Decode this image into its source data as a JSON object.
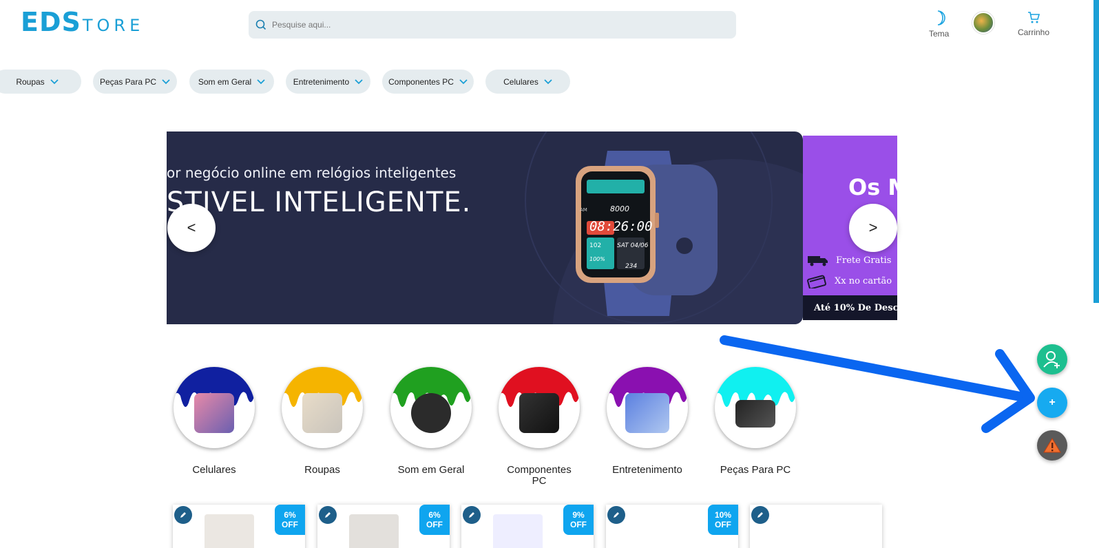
{
  "header": {
    "logo_strong": "EDS",
    "logo_light": "TORE",
    "search_placeholder": "Pesquise aqui...",
    "theme_label": "Tema",
    "cart_label": "Carrinho"
  },
  "nav": {
    "pills": [
      "Roupas",
      "Peças Para PC",
      "Som em Geral",
      "Entretenimento",
      "Componentes PC",
      "Celulares"
    ]
  },
  "carousel": {
    "slide_line1": "or negócio online em relógios inteligentes",
    "slide_line2": "STIVEL INTELIGENTE.",
    "watch_time": "08:26:00",
    "watch_steps": "8000",
    "watch_date": "SAT 04/06",
    "watch_heart": "102",
    "watch_battery": "100%",
    "watch_cal": "234",
    "watch_am": "AM",
    "next_slide_title": "Os M",
    "next_slide_row1": "Frete Gratis",
    "next_slide_row2": "Xx no cartão",
    "next_slide_bottom": "Até 10% De Desco",
    "prev_label": "<",
    "next_label": ">"
  },
  "categories": [
    {
      "name": "Celulares",
      "color": "#1020a0"
    },
    {
      "name": "Roupas",
      "color": "#f5b400"
    },
    {
      "name": "Som em Geral",
      "color": "#20a020"
    },
    {
      "name": "Componentes PC",
      "color": "#e01020"
    },
    {
      "name": "Entretenimento",
      "color": "#8a10b0"
    },
    {
      "name": "Peças Para PC",
      "color": "#10f0f0"
    }
  ],
  "products": [
    {
      "badge": "6% OFF"
    },
    {
      "badge": "6% OFF"
    },
    {
      "badge": "9% OFF"
    },
    {
      "badge": "10% OFF"
    },
    {
      "badge": ""
    }
  ],
  "fab": {
    "plus_label": "+"
  },
  "colors": {
    "brand": "#1a9fd6",
    "banner_bg": "#262b48",
    "annotation_arrow": "#0a66f0"
  }
}
